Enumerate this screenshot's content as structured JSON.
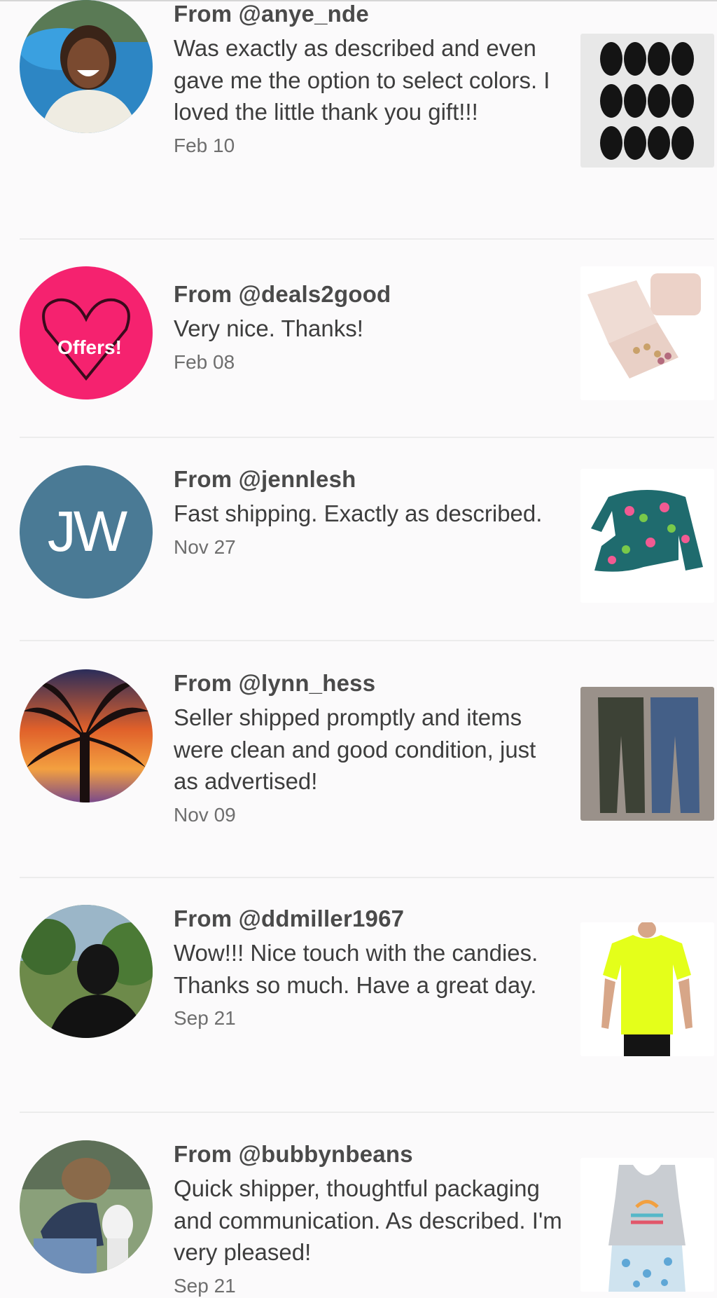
{
  "reviews": [
    {
      "from": "From @anye_nde",
      "message": "Was exactly as described and even gave me the option to select colors. I loved the little thank you gift!!!",
      "date": "Feb 10",
      "avatar": "profile-photo-man-smiling",
      "item": "black-face-masks"
    },
    {
      "from": "From @deals2good",
      "message": "Very nice. Thanks!",
      "date": "Feb 08",
      "avatar": "offers-heart-logo",
      "avatar_text": "Offers!",
      "item": "pink-jewelry-box"
    },
    {
      "from": "From @jennlesh",
      "message": "Fast shipping. Exactly as described.",
      "date": "Nov 27",
      "avatar": "initials-avatar",
      "avatar_text": "JW",
      "item": "floral-swimsuit"
    },
    {
      "from": "From @lynn_hess",
      "message": "Seller shipped promptly and items were clean and good condition, just as advertised!",
      "date": "Nov 09",
      "avatar": "palm-tree-sunset",
      "item": "two-pairs-jeans"
    },
    {
      "from": "From @ddmiller1967",
      "message": "Wow!!! Nice touch with the candies. Thanks so much. Have a great day.",
      "date": "Sep 21",
      "avatar": "profile-photo-outdoors",
      "item": "neon-yellow-tshirt"
    },
    {
      "from": "From @bubbynbeans",
      "message": "Quick shipper, thoughtful packaging and communication. As described. I'm very pleased!",
      "date": "Sep 21",
      "avatar": "profile-photo-girl-with-cat",
      "item": "tank-top-and-shorts"
    }
  ],
  "colors": {
    "background": "#fbfafb",
    "divider": "#ececec",
    "jw_avatar": "#4a7a95",
    "offers_avatar": "#f5226f"
  }
}
